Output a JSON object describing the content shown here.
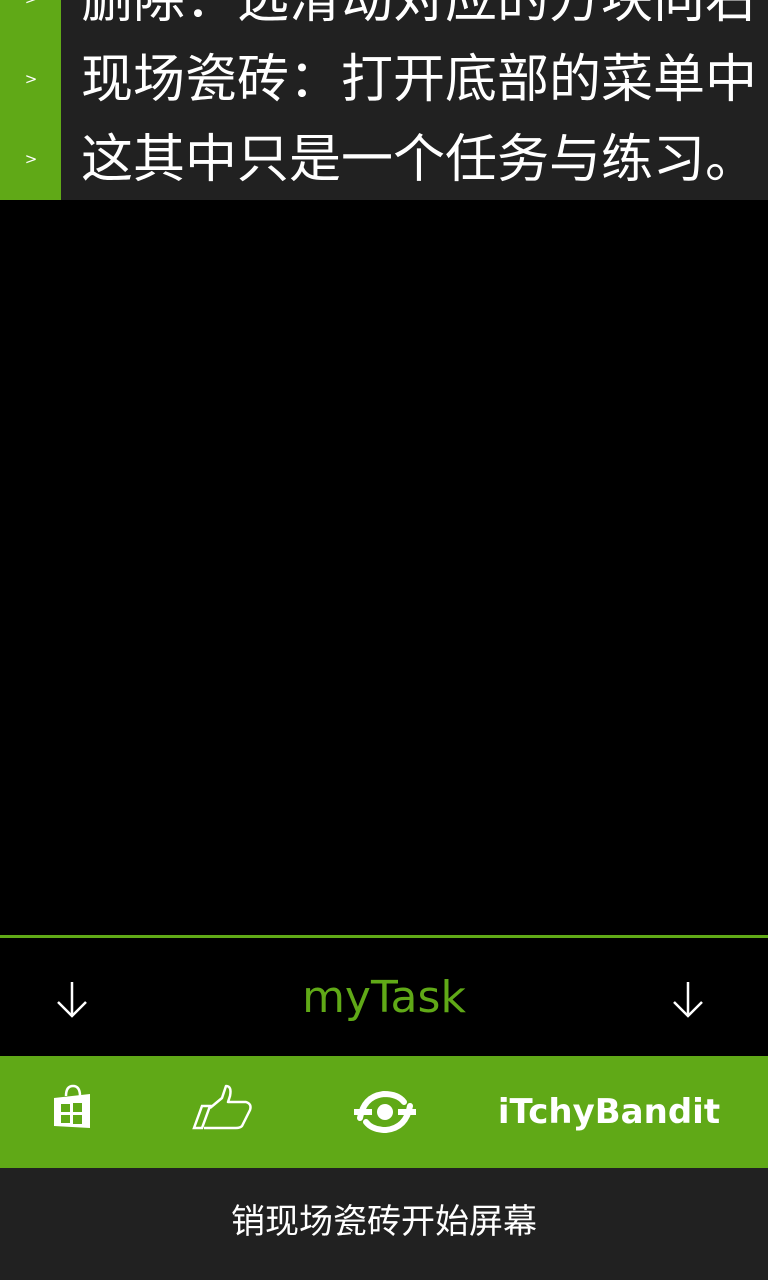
{
  "tasks": [
    {
      "chevron": ">",
      "text": "删除：选滑动对应的方块向右"
    },
    {
      "chevron": ">",
      "text": "现场瓷砖：打开底部的菜单中"
    },
    {
      "chevron": ">",
      "text": "这其中只是一个任务与练习。"
    }
  ],
  "header": {
    "title": "myTask",
    "left_icon": "down-arrow-icon",
    "right_icon": "down-arrow-icon"
  },
  "toolbar": {
    "store_icon": "store-bag-icon",
    "like_icon": "thumbs-up-icon",
    "bandit_icon": "bandit-logo-icon",
    "brand_label": "iTchyBandit"
  },
  "bottom": {
    "label": "销现场瓷砖开始屏幕"
  },
  "colors": {
    "accent": "#60a917",
    "background": "#000000",
    "panel": "#212121",
    "text": "#ffffff"
  }
}
